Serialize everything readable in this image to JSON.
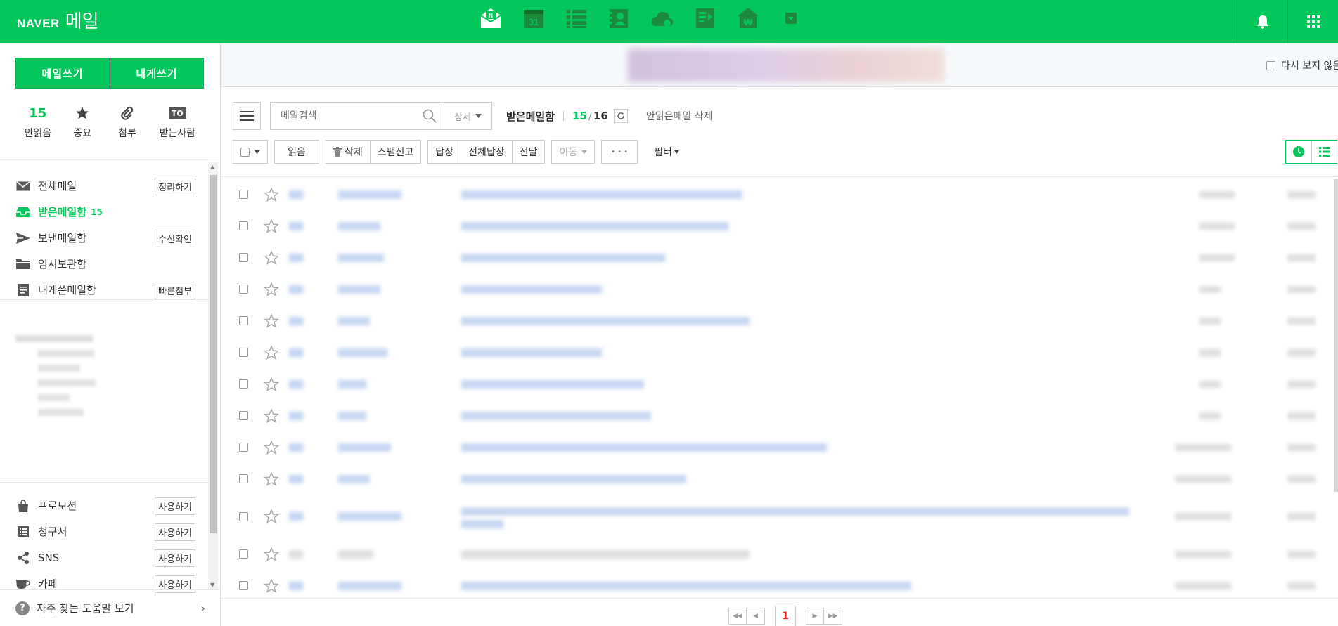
{
  "header": {
    "logo_brand": "NAVER",
    "logo_service": "메일",
    "apps": [
      "mail-app-icon",
      "calendar-app-icon",
      "tasks-app-icon",
      "contacts-app-icon",
      "cloud-app-icon",
      "memo-app-icon",
      "pay-app-icon",
      "more-dropdown-icon"
    ],
    "calendar_day": "31",
    "mail_badge": "N",
    "pay_symbol": "₩",
    "accent_color": "#03c75a"
  },
  "compose": {
    "write_label": "메일쓰기",
    "self_label": "내게쓰기"
  },
  "quick": {
    "unread_count": "15",
    "unread_label": "안읽음",
    "important_label": "중요",
    "attach_label": "첨부",
    "to_badge": "TO",
    "recipient_label": "받는사람"
  },
  "folders": [
    {
      "name": "전체메일",
      "button": "정리하기"
    },
    {
      "name": "받은메일함",
      "count": "15"
    },
    {
      "name": "보낸메일함",
      "button": "수신확인"
    },
    {
      "name": "임시보관함"
    },
    {
      "name": "내게쓴메일함",
      "button": "빠른첨부"
    }
  ],
  "extras": [
    {
      "name": "프로모션",
      "button": "사용하기"
    },
    {
      "name": "청구서",
      "button": "사용하기"
    },
    {
      "name": "SNS",
      "button": "사용하기"
    },
    {
      "name": "카페",
      "button": "사용하기"
    }
  ],
  "help": {
    "label": "자주 찾는 도움말 보기"
  },
  "banner": {
    "noshow_label": "다시 보지 않음"
  },
  "search": {
    "placeholder": "메일검색",
    "detail_label": "상세"
  },
  "mailbox": {
    "title": "받은메일함",
    "unread": "15",
    "separator": "/",
    "total": "16",
    "delete_unread": "안읽은메일 삭제"
  },
  "toolbar": {
    "read": "읽음",
    "delete": "삭제",
    "spam": "스팸신고",
    "reply": "답장",
    "reply_all": "전체답장",
    "forward": "전달",
    "move": "이동",
    "more": "• • •",
    "filter": "필터"
  },
  "pagination": {
    "current": "1"
  }
}
